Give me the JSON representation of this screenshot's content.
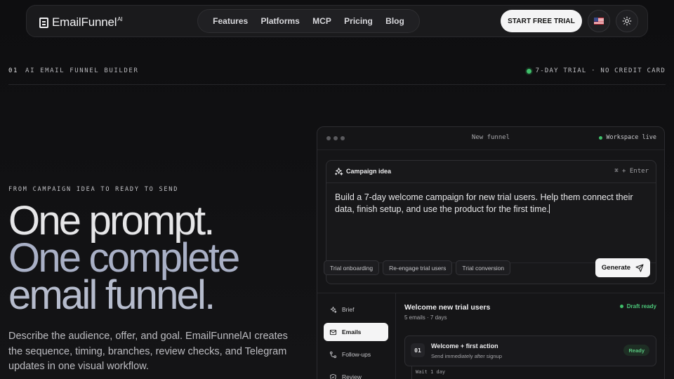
{
  "nav": {
    "logo_text": "EmailFunnel",
    "logo_sup": "AI",
    "menu": [
      "Features",
      "Platforms",
      "MCP",
      "Pricing",
      "Blog"
    ],
    "cta": "START FREE TRIAL",
    "flag_icon": "us-flag-icon",
    "theme_icon": "sun-icon"
  },
  "topbar": {
    "num": "01",
    "label": "AI EMAIL FUNNEL BUILDER",
    "status": "7-DAY TRIAL · NO CREDIT CARD"
  },
  "hero": {
    "eyebrow": "FROM CAMPAIGN IDEA TO READY TO SEND",
    "line1": "One prompt.",
    "line2": "One complete",
    "line3": "email funnel.",
    "description": "Describe the audience, offer, and goal. EmailFunnelAI creates the sequence, timing, branches, review checks, and Telegram updates in one visual workflow."
  },
  "window": {
    "title": "New funnel",
    "status": "Workspace live",
    "prompt": {
      "title": "Campaign idea",
      "shortcut": "⌘ + Enter",
      "text": "Build a 7-day welcome campaign for new trial users. Help them connect their data, finish setup, and use the product for the first time.",
      "chips": [
        "Trial onboarding",
        "Re-engage trial users",
        "Trial conversion"
      ],
      "generate": "Generate"
    },
    "sidebar": [
      "Brief",
      "Emails",
      "Follow-ups",
      "Review"
    ],
    "main": {
      "title": "Welcome new trial users",
      "subtitle": "5 emails · 7 days",
      "badge": "Draft ready",
      "step": {
        "num": "01",
        "title": "Welcome + first action",
        "sub": "Send immediately after signup",
        "badge": "Ready"
      },
      "wait": "Wait 1 day"
    }
  },
  "colors": {
    "accent_green": "#3fbf6a",
    "headline_blue": "#a9b0c6"
  }
}
